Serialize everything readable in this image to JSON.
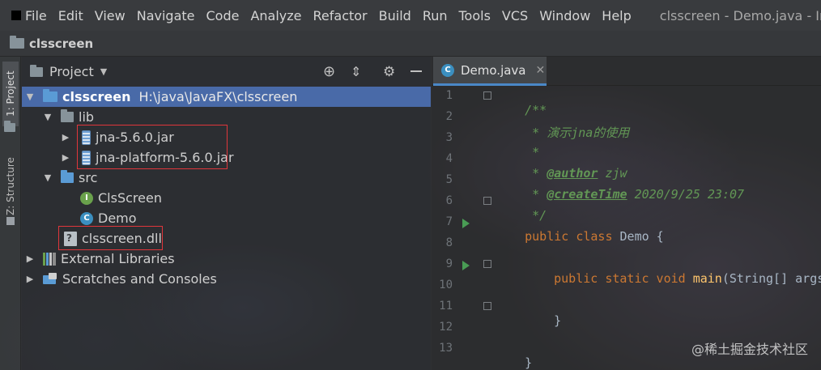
{
  "menubar": {
    "items": [
      "File",
      "Edit",
      "View",
      "Navigate",
      "Code",
      "Analyze",
      "Refactor",
      "Build",
      "Run",
      "Tools",
      "VCS",
      "Window",
      "Help"
    ],
    "window_title": "clsscreen - Demo.java - Intell"
  },
  "navbar": {
    "project_name": "clsscreen"
  },
  "left_stripe": {
    "project_tab": "1: Project",
    "structure_tab": "Z: Structure"
  },
  "project_panel": {
    "title": "Project",
    "tree": {
      "root_name": "clsscreen",
      "root_path": "H:\\java\\JavaFX\\clsscreen",
      "lib": "lib",
      "jar1": "jna-5.6.0.jar",
      "jar2": "jna-platform-5.6.0.jar",
      "src": "src",
      "class1": "ClsScreen",
      "class2": "Demo",
      "dll": "clsscreen.dll",
      "external_libraries": "External Libraries",
      "scratches": "Scratches and Consoles"
    }
  },
  "editor": {
    "tab_label": "Demo.java",
    "line_numbers": [
      "1",
      "2",
      "3",
      "4",
      "5",
      "6",
      "7",
      "8",
      "9",
      "10",
      "11",
      "12",
      "13"
    ],
    "code": {
      "l1": "/**",
      "l2": " * 演示jna的使用",
      "l3": " *",
      "l4_tag": "@author",
      "l4_val": " zjw",
      "l5_tag": "@createTime",
      "l5_val": " 2020/9/25 23:07",
      "l6": " */",
      "l7_kw": "public class",
      "l7_rest": " Demo {",
      "l9_kw": "public static void",
      "l9_fn": "main",
      "l9_rest": "(String[] args) {",
      "l11": "}",
      "l13": "}"
    }
  },
  "watermark": "@稀土掘金技术社区",
  "colors": {
    "selection": "#4b6eaf",
    "highlight_box": "#e0363b",
    "keyword": "#cc7832",
    "comment": "#629755"
  }
}
